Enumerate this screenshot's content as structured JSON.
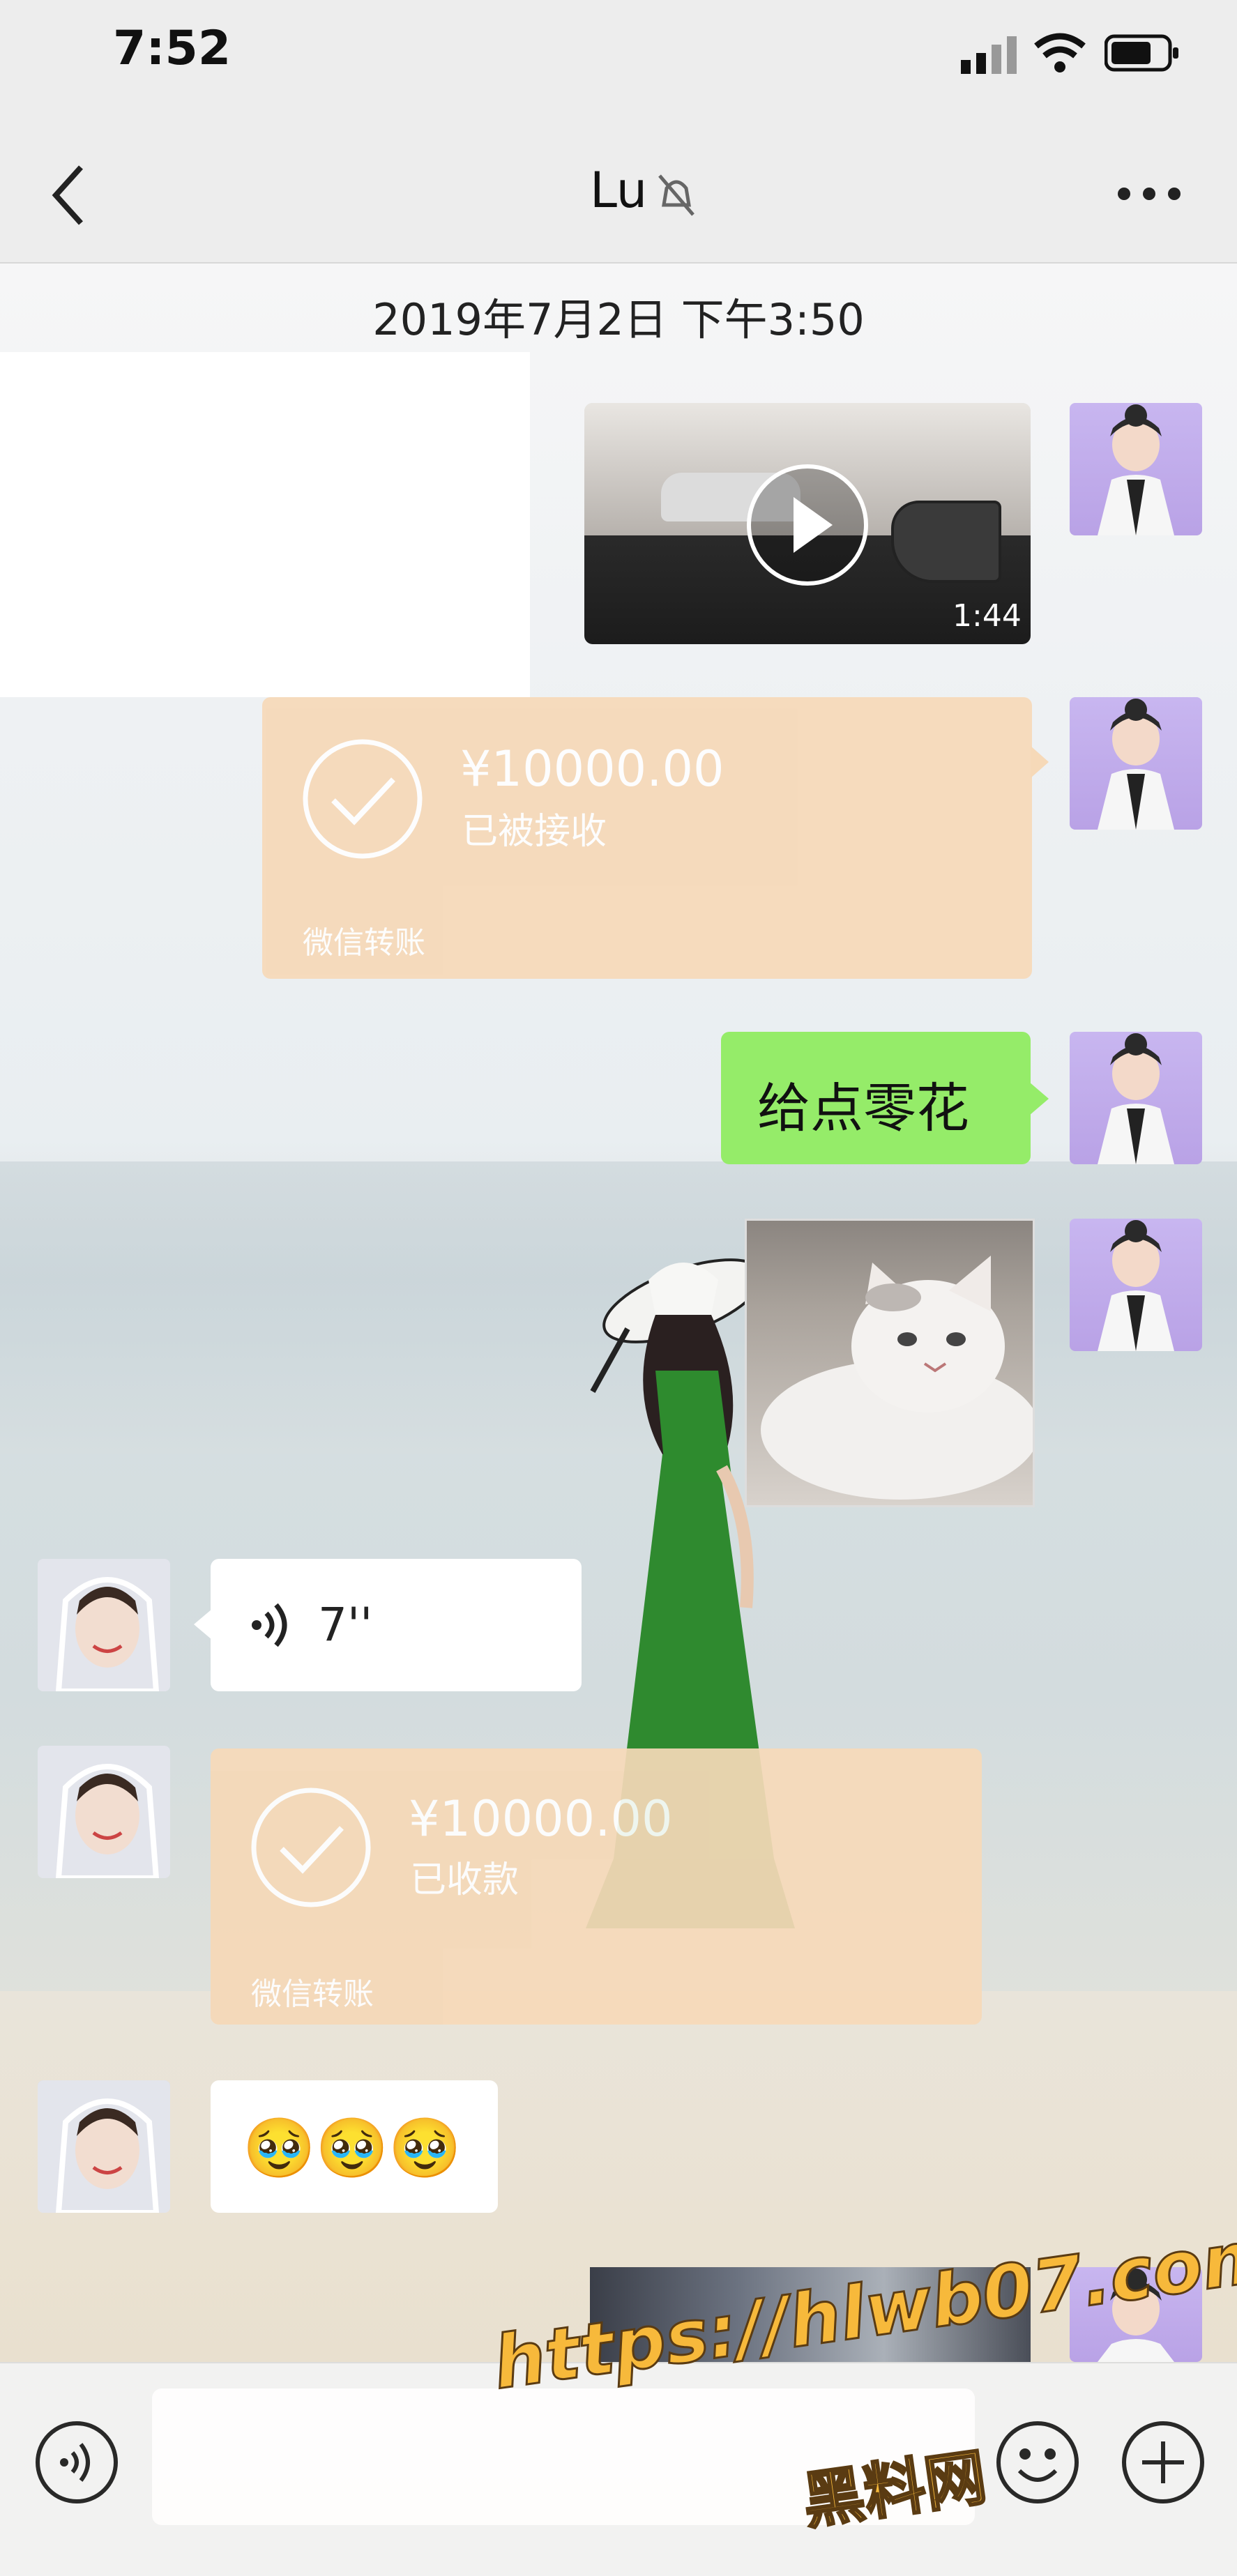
{
  "status_bar": {
    "time": "7:52"
  },
  "nav": {
    "title": "Lu"
  },
  "chat": {
    "timestamp": "2019年7月2日 下午3:50",
    "video": {
      "duration": "1:44"
    },
    "transfer_sent": {
      "amount": "¥10000.00",
      "status": "已被接收",
      "footer": "微信转账"
    },
    "text_sent": "给点零花",
    "voice": {
      "length": "7''"
    },
    "transfer_received": {
      "amount": "¥10000.00",
      "status": "已收款",
      "footer": "微信转账"
    },
    "emoji_message": "🥹🥹🥹"
  },
  "watermark": {
    "url": "https://hlwb07.com",
    "site": "黑料网"
  },
  "colors": {
    "bubble_green": "#95ec69",
    "transfer": "#f6d9b8",
    "avatar_purple": "#c8b6f0"
  }
}
